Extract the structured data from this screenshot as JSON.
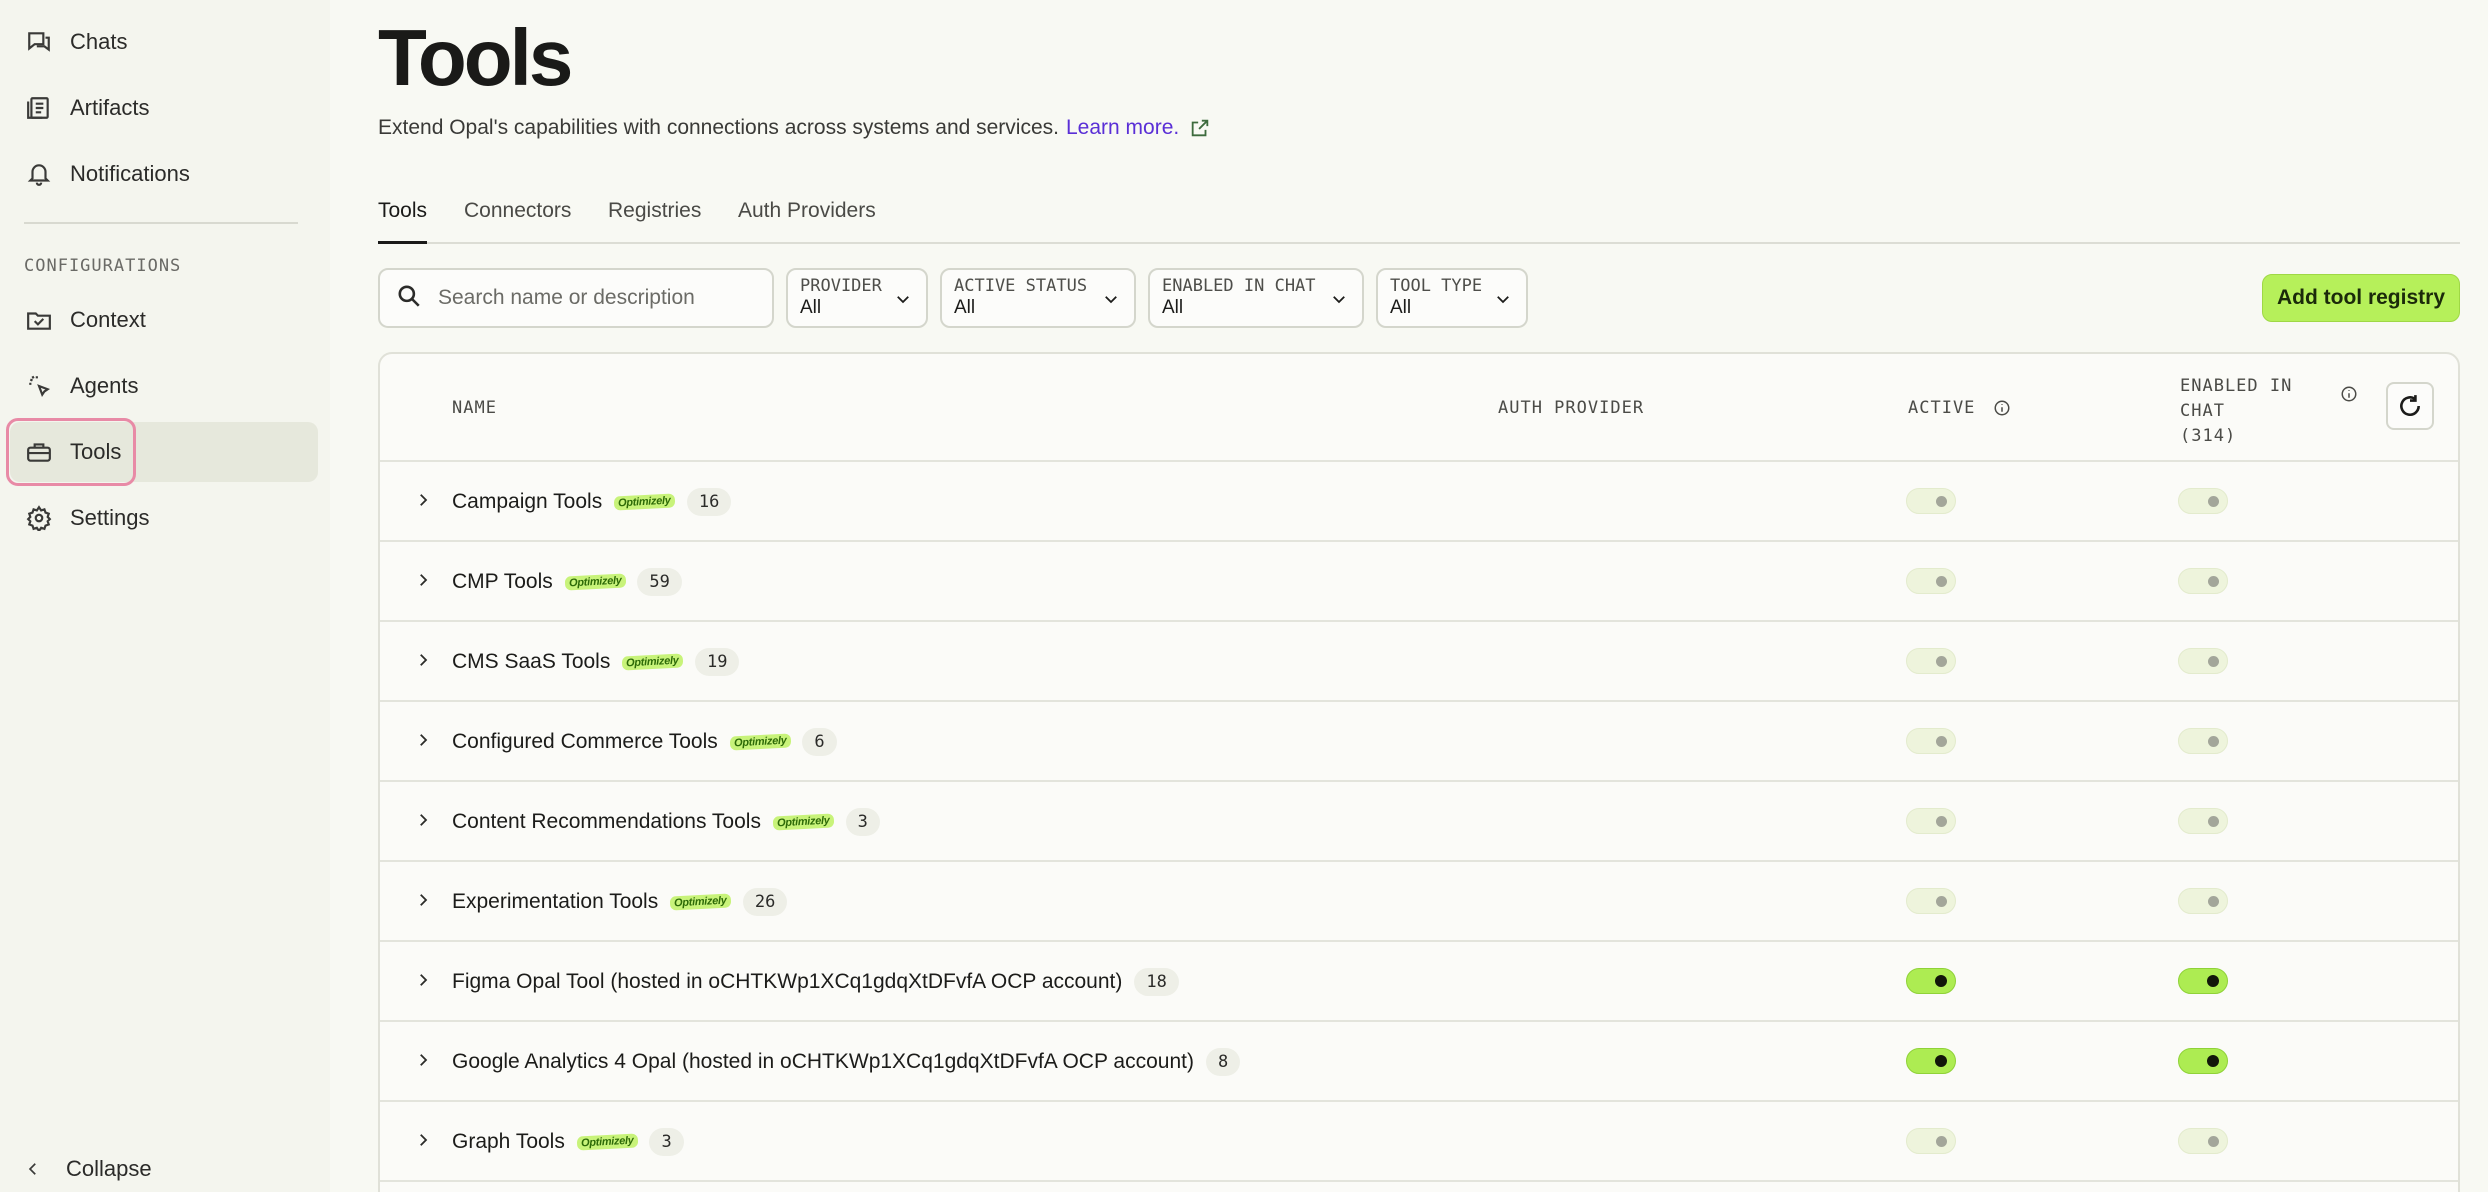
{
  "sidebar": {
    "items": [
      {
        "label": "Chats",
        "icon": "chat-icon"
      },
      {
        "label": "Artifacts",
        "icon": "document-list-icon"
      },
      {
        "label": "Notifications",
        "icon": "bell-icon"
      },
      {
        "label": "Context",
        "icon": "folder-check-icon"
      },
      {
        "label": "Agents",
        "icon": "sparkle-cursor-icon"
      },
      {
        "label": "Tools",
        "icon": "toolbox-icon"
      },
      {
        "label": "Settings",
        "icon": "gear-icon"
      }
    ],
    "section_label": "CONFIGURATIONS",
    "collapse_label": "Collapse",
    "active_item": "Tools"
  },
  "header": {
    "title": "Tools",
    "subtitle": "Extend Opal's capabilities with connections across systems and services.",
    "learn_more": "Learn more."
  },
  "tabs": [
    {
      "label": "Tools",
      "active": true
    },
    {
      "label": "Connectors",
      "active": false
    },
    {
      "label": "Registries",
      "active": false
    },
    {
      "label": "Auth Providers",
      "active": false
    }
  ],
  "search": {
    "placeholder": "Search name or description",
    "value": ""
  },
  "filters": [
    {
      "label": "PROVIDER",
      "value": "All"
    },
    {
      "label": "ACTIVE STATUS",
      "value": "All"
    },
    {
      "label": "ENABLED IN CHAT",
      "value": "All"
    },
    {
      "label": "TOOL TYPE",
      "value": "All"
    }
  ],
  "add_button_label": "Add tool registry",
  "table": {
    "columns": {
      "name": "NAME",
      "auth_provider": "AUTH PROVIDER",
      "active": "ACTIVE",
      "enabled_line1": "ENABLED IN",
      "enabled_line2": "CHAT",
      "enabled_count": "(314)"
    },
    "rows": [
      {
        "name": "Campaign Tools",
        "logo": "Optimizely",
        "count": "16",
        "active": false,
        "enabled": false
      },
      {
        "name": "CMP Tools",
        "logo": "Optimizely",
        "count": "59",
        "active": false,
        "enabled": false
      },
      {
        "name": "CMS SaaS Tools",
        "logo": "Optimizely",
        "count": "19",
        "active": false,
        "enabled": false
      },
      {
        "name": "Configured Commerce Tools",
        "logo": "Optimizely",
        "count": "6",
        "active": false,
        "enabled": false
      },
      {
        "name": "Content Recommendations Tools",
        "logo": "Optimizely",
        "count": "3",
        "active": false,
        "enabled": false
      },
      {
        "name": "Experimentation Tools",
        "logo": "Optimizely",
        "count": "26",
        "active": false,
        "enabled": false
      },
      {
        "name": "Figma Opal Tool (hosted in oCHTKWp1XCq1gdqXtDFvfA OCP account)",
        "logo": "",
        "count": "18",
        "active": true,
        "enabled": true
      },
      {
        "name": "Google Analytics 4 Opal (hosted in oCHTKWp1XCq1gdqXtDFvfA OCP account)",
        "logo": "",
        "count": "8",
        "active": true,
        "enabled": true
      },
      {
        "name": "Graph Tools",
        "logo": "Optimizely",
        "count": "3",
        "active": false,
        "enabled": false
      }
    ]
  },
  "colors": {
    "accent_green": "#b6f05a",
    "link_purple": "#5a2fd6",
    "active_outline_pink": "#e88aa6"
  }
}
